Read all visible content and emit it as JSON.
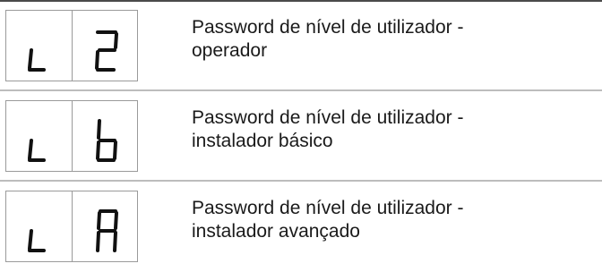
{
  "rows": [
    {
      "code": [
        "L",
        "2"
      ],
      "description_line1": "Password de nível de utilizador -",
      "description_line2": "operador"
    },
    {
      "code": [
        "L",
        "b"
      ],
      "description_line1": "Password de nível de utilizador -",
      "description_line2": "instalador básico"
    },
    {
      "code": [
        "L",
        "A"
      ],
      "description_line1": "Password de nível de utilizador -",
      "description_line2": "instalador avançado"
    }
  ]
}
